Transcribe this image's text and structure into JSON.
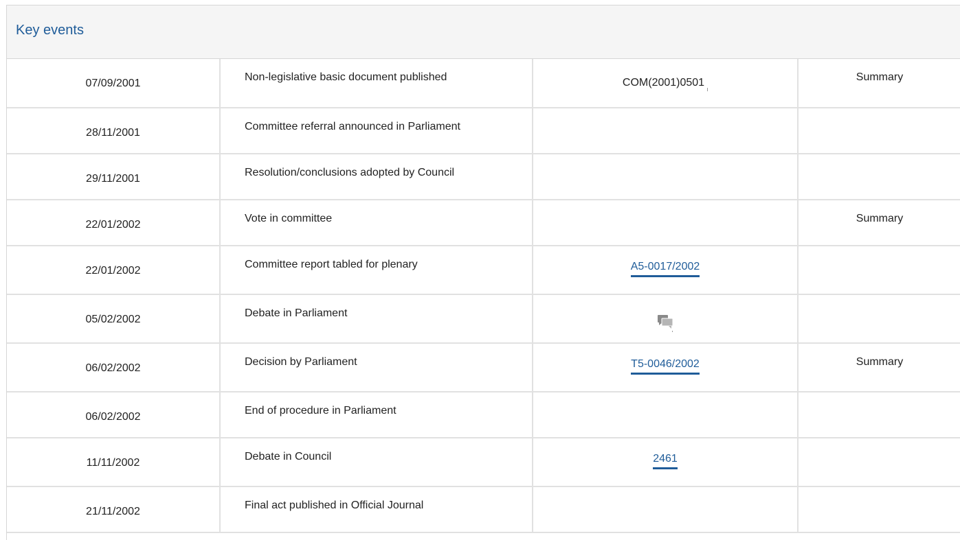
{
  "panel": {
    "title": "Key events"
  },
  "events": [
    {
      "date": "07/09/2001",
      "event": "Non-legislative basic document published",
      "doc": "COM(2001)0501",
      "doc_type": "text",
      "summary": "Summary"
    },
    {
      "date": "28/11/2001",
      "event": "Committee referral announced in Parliament",
      "doc": "",
      "doc_type": "none",
      "summary": ""
    },
    {
      "date": "29/11/2001",
      "event": "Resolution/conclusions adopted by Council",
      "doc": "",
      "doc_type": "none",
      "summary": ""
    },
    {
      "date": "22/01/2002",
      "event": "Vote in committee",
      "doc": "",
      "doc_type": "none",
      "summary": "Summary"
    },
    {
      "date": "22/01/2002",
      "event": "Committee report tabled for plenary",
      "doc": "A5-0017/2002",
      "doc_type": "link",
      "summary": ""
    },
    {
      "date": "05/02/2002",
      "event": "Debate in Parliament",
      "doc": "",
      "doc_type": "debate-icon",
      "summary": ""
    },
    {
      "date": "06/02/2002",
      "event": "Decision by Parliament",
      "doc": "T5-0046/2002",
      "doc_type": "link",
      "summary": "Summary"
    },
    {
      "date": "06/02/2002",
      "event": "End of procedure in Parliament",
      "doc": "",
      "doc_type": "none",
      "summary": ""
    },
    {
      "date": "11/11/2002",
      "event": "Debate in Council",
      "doc": "2461",
      "doc_type": "link",
      "summary": ""
    },
    {
      "date": "21/11/2002",
      "event": "Final act published in Official Journal",
      "doc": "",
      "doc_type": "none",
      "summary": ""
    }
  ],
  "colors": {
    "accent": "#1f5c99",
    "header_bg": "#f5f5f5",
    "border": "#e1e1e1"
  }
}
